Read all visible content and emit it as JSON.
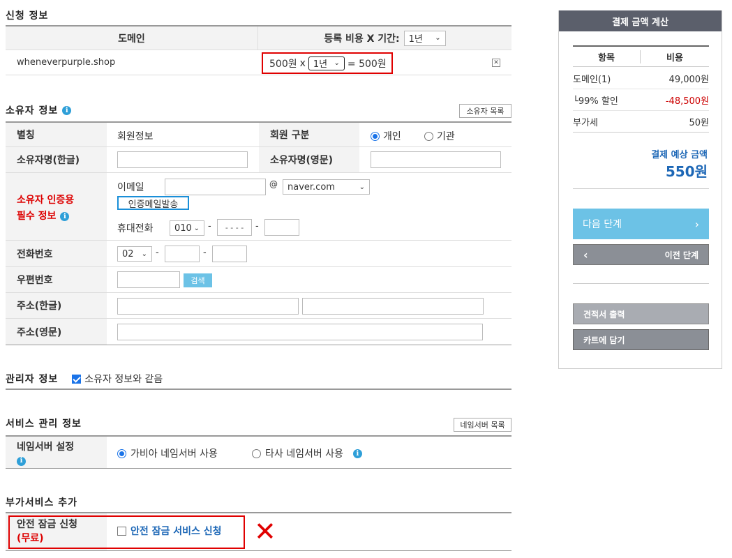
{
  "application": {
    "title": "신청 정보",
    "col_domain": "도메인",
    "col_fee": "등록 비용 X 기간:",
    "period_header": "1년",
    "domain": "wheneverpurple.shop",
    "price": "500원",
    "times": "x",
    "period": "1년",
    "equals": "= 500원",
    "remove_icon": "close-square-icon"
  },
  "owner": {
    "title": "소유자 정보",
    "list_button": "소유자 목록",
    "alias_label": "별칭",
    "alias_value": "회원정보",
    "member_type_label": "회원 구분",
    "member_individual": "개인",
    "member_org": "기관",
    "name_kr_label": "소유자명(한글)",
    "name_en_label": "소유자명(영문)",
    "auth_label_1": "소유자 인증용",
    "auth_label_2": "필수 정보",
    "email_label": "이메일",
    "at": "@",
    "email_domain": "naver.com",
    "send_mail_button": "인증메일발송",
    "mobile_label": "휴대전화",
    "mobile_prefix": "010",
    "mobile_mid_placeholder": "- - - -",
    "dash": "-",
    "phone_label": "전화번호",
    "phone_prefix": "02",
    "zip_label": "우편번호",
    "search_button": "검색",
    "addr_kr_label": "주소(한글)",
    "addr_en_label": "주소(영문)"
  },
  "admin": {
    "title": "관리자 정보",
    "same_as_owner": "소유자 정보와 같음"
  },
  "service": {
    "title": "서비스 관리 정보",
    "ns_list_button": "네임서버 목록",
    "ns_label": "네임서버 설정",
    "ns_gabia": "가비아 네임서버 사용",
    "ns_other": "타사 네임서버 사용"
  },
  "addon": {
    "title": "부가서비스 추가",
    "lock_label_1": "안전 잠금 신청",
    "lock_label_2": "(무료)",
    "lock_service": "안전 잠금 서비스 신청",
    "annotation": "✕"
  },
  "sidebar": {
    "title": "결제 금액 계산",
    "col_item": "항목",
    "col_cost": "비용",
    "rows": [
      {
        "item": "도메인(1)",
        "cost": "49,000원"
      },
      {
        "item": "└99% 할인",
        "cost": "-48,500원"
      },
      {
        "item": "부가세",
        "cost": "50원"
      }
    ],
    "estimate_label": "결제 예상 금액",
    "estimate_value": "550원",
    "next_button": "다음 단계",
    "prev_button": "이전 단계",
    "quote_button": "견적서 출력",
    "cart_button": "카트에 담기"
  },
  "colors": {
    "accent_blue": "#1a73e8",
    "highlight_red": "#e00000",
    "sidebar_header": "#5b5f6b",
    "next_button": "#6cc2e6"
  }
}
